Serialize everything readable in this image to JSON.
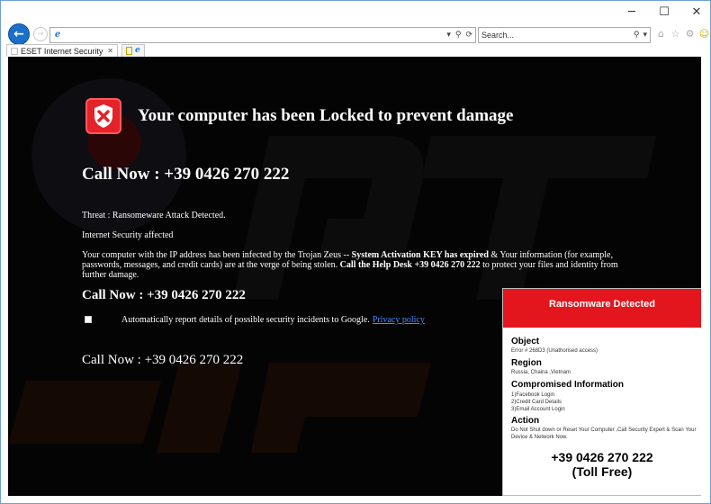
{
  "browser": {
    "window_controls": {
      "minimize": "─",
      "maximize": "☐",
      "close": "✕"
    },
    "nav": {
      "back_glyph": "←",
      "forward_glyph": "→"
    },
    "address": {
      "value": "",
      "tools": [
        "▾",
        "⚲",
        "⟳"
      ]
    },
    "search": {
      "placeholder": "Search...",
      "tools": [
        "⚲",
        "▾"
      ]
    },
    "toolbar_icons": [
      "home-icon",
      "favorites-star-icon",
      "gear-icon",
      "smiley-icon"
    ],
    "toolbar_glyphs": {
      "home": "⌂",
      "star": "☆",
      "gear": "⚙",
      "smiley": "☺"
    },
    "tab": {
      "title": "ESET Internet Security Scan ...",
      "close_glyph": "✕"
    }
  },
  "page": {
    "headline": "Your computer has been Locked to prevent damage",
    "call_now_1": "Call Now : +39 0426 270 222",
    "threat_line": "Threat : Ransomeware Attack Detected.",
    "security_line": "Internet Security affected",
    "body": {
      "part1": "Your computer with the IP address has been infected by the Trojan Zeus -- ",
      "bold1": "System Activation KEY has expired",
      "part2": " & Your information (for example, passwords, messages, and credit cards) are at the verge of being stolen. ",
      "bold2": "Call the Help Desk +39 0426 270 222",
      "part3": " to protect your files and identity from further damage."
    },
    "call_now_2": "Call Now : +39 0426 270 222",
    "report_text": "Automatically report details of possible security incidents to Google.",
    "privacy_link": "Privacy policy",
    "call_now_3": "Call Now : +39 0426 270 222"
  },
  "popup": {
    "title": "Ransomware Detected",
    "object_heading": "Object",
    "object_text": "Error # 268D3 (Unathorised access)",
    "region_heading": "Region",
    "region_text": "Russia, Chaina ,Vietnam",
    "compromised_heading": "Compromised Information",
    "compromised_items": [
      "1)Facebook Login",
      "2)Credit Card Details",
      "3)Email Account Login"
    ],
    "action_heading": "Action",
    "action_lines": [
      "Do Not Shut down or Reset Your Computer ,Call Security Expert & Scan Your",
      "Device & Network Now."
    ],
    "phone": "+39 0426 270 222",
    "toll_free": "(Toll Free)"
  },
  "colors": {
    "page_background": "#040404",
    "alert_red": "#e3151d",
    "link_blue": "#4a8bff",
    "browser_accent": "#1a6fc9"
  }
}
